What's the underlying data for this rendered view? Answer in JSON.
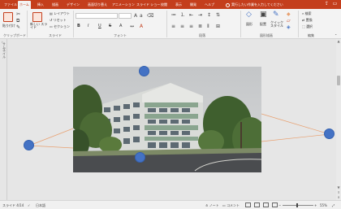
{
  "ribbon_tabs": [
    {
      "label": "ファイル"
    },
    {
      "label": "ホーム"
    },
    {
      "label": "挿入"
    },
    {
      "label": "描画"
    },
    {
      "label": "デザイン"
    },
    {
      "label": "画面切り替え"
    },
    {
      "label": "アニメーション"
    },
    {
      "label": "スライド ショー"
    },
    {
      "label": "校閲"
    },
    {
      "label": "表示"
    },
    {
      "label": "開発"
    },
    {
      "label": "ヘルプ"
    }
  ],
  "tell_me": "実行したい作業を入力してください",
  "groups": {
    "clipboard": "クリップボード",
    "slides": "スライド",
    "font": "フォント",
    "paragraph": "段落",
    "drawing": "図形描画",
    "editing": "編集"
  },
  "clipboard": {
    "paste": "貼り付け"
  },
  "slides": {
    "new_slide": "新しい スライド",
    "layout": "レイアウト",
    "reset": "リセット",
    "section": "セクション"
  },
  "font": {
    "font_name": "",
    "font_size": "",
    "bold": "B",
    "italic": "I",
    "underline": "U",
    "strike": "S",
    "shadow": "A"
  },
  "drawing": {
    "shapes": "図形",
    "arrange": "配置",
    "quick_styles": "クイック スタイル"
  },
  "editing": {
    "find": "検索",
    "replace": "置換",
    "select": "選択"
  },
  "thumbnail_label": "サムネイル",
  "status": {
    "slide_counter": "スライド 4/14",
    "language": "日本語",
    "notes": "ノート",
    "comments": "コメント",
    "zoom": "55%"
  },
  "colors": {
    "accent": "#c43e1c",
    "handle": "#4472c4",
    "connector": "#e8a070"
  }
}
